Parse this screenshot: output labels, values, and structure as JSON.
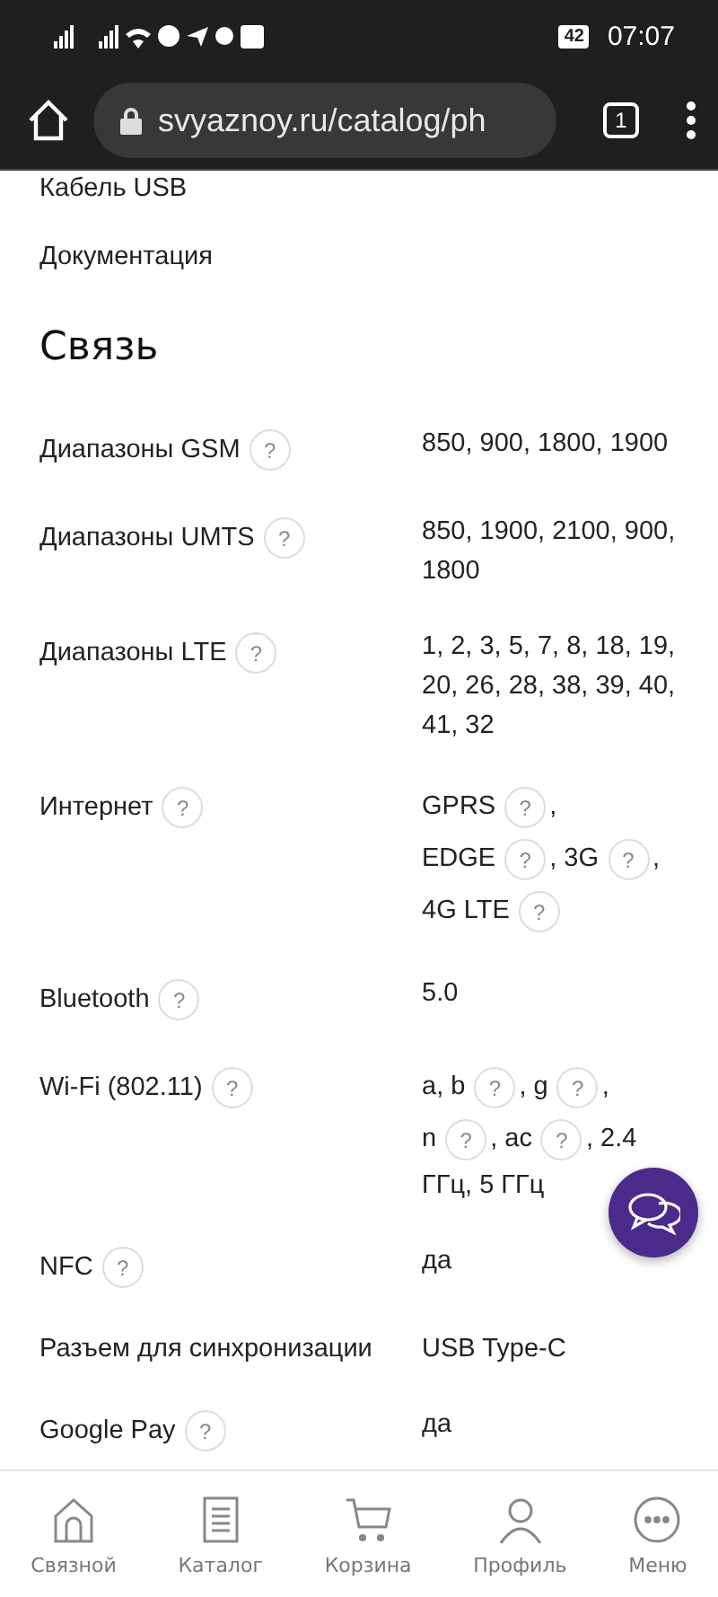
{
  "status_bar": {
    "battery": "42",
    "time": "07:07"
  },
  "browser": {
    "url": "svyaznoy.ru/catalog/ph",
    "tab_count": "1"
  },
  "items_above": [
    "Кабель USB",
    "Документация"
  ],
  "section": {
    "title": "Связь",
    "rows": [
      {
        "label": "Диапазоны GSM",
        "help": "?",
        "value": [
          {
            "text": "850, 900, 1800, 1900"
          }
        ]
      },
      {
        "label": "Диапазоны UMTS",
        "help": "?",
        "value": [
          {
            "text": "850, 1900, 2100, 900, 1800"
          }
        ]
      },
      {
        "label": "Диапазоны LTE",
        "help": "?",
        "value": [
          {
            "text": "1, 2, 3, 5, 7, 8, 18, 19, 20, 26, 28, 38, 39, 40, 41, 32"
          }
        ]
      },
      {
        "label": "Интернет",
        "help": "?",
        "value": [
          {
            "text": "GPRS",
            "help": "?",
            "suffix": ","
          },
          {
            "text": "EDGE",
            "help": "?",
            "suffix": ","
          },
          {
            "text": "3G",
            "help": "?",
            "suffix": ","
          },
          {
            "text": "4G LTE",
            "help": "?"
          }
        ]
      },
      {
        "label": "Bluetooth",
        "help": "?",
        "value": [
          {
            "text": "5.0"
          }
        ]
      },
      {
        "label": "Wi-Fi (802.11)",
        "help": "?",
        "value": [
          {
            "text": "a, b",
            "help": "?",
            "suffix": ","
          },
          {
            "text": "g",
            "help": "?",
            "suffix": ","
          },
          {
            "text": "n",
            "help": "?",
            "suffix": ","
          },
          {
            "text": "ac",
            "help": "?",
            "suffix": ", 2.4"
          },
          {
            "text": "ГГц, 5 ГГц"
          }
        ]
      },
      {
        "label": "NFC",
        "help": "?",
        "value": [
          {
            "text": "да"
          }
        ]
      },
      {
        "label": "Разъем для синхронизации",
        "value": [
          {
            "text": "USB Type-C"
          }
        ]
      },
      {
        "label": "Google Pay",
        "help": "?",
        "value": [
          {
            "text": "да"
          }
        ]
      }
    ]
  },
  "nav": [
    {
      "kind": "home",
      "label": "Связной"
    },
    {
      "kind": "catalog",
      "label": "Каталог"
    },
    {
      "kind": "cart",
      "label": "Корзина"
    },
    {
      "kind": "profile",
      "label": "Профиль"
    },
    {
      "kind": "menu",
      "label": "Меню"
    }
  ]
}
